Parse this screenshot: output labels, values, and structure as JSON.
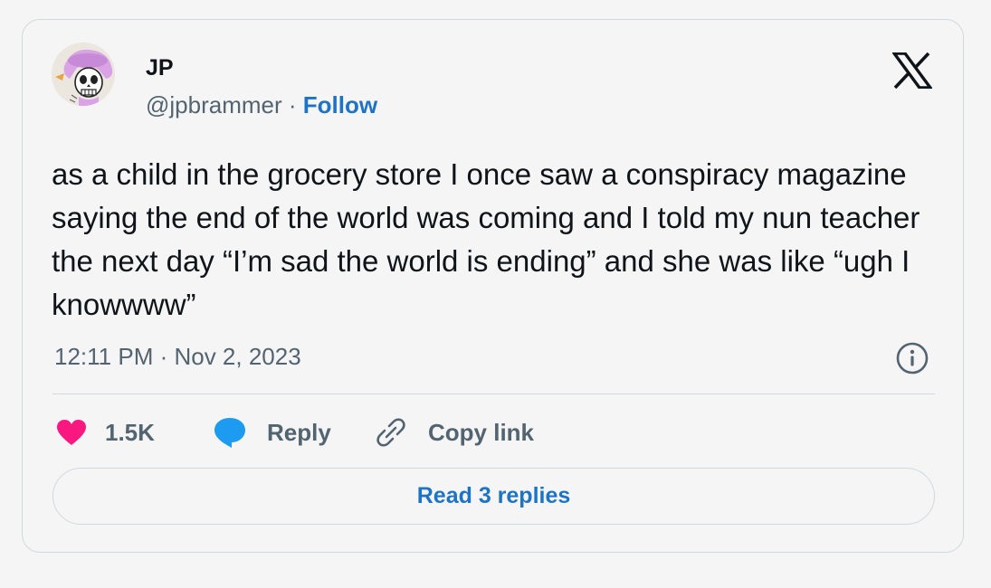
{
  "author": {
    "name": "JP",
    "handle": "@jpbrammer",
    "separator": " · ",
    "follow_label": "Follow"
  },
  "tweet": {
    "text": "as a child in the grocery store I once saw a conspiracy magazine saying the end of the world was coming and I told my nun teacher the next day “I’m sad the world is ending” and she was like “ugh I knowwww”",
    "timestamp": "12:11 PM · Nov 2, 2023"
  },
  "actions": {
    "like_count": "1.5K",
    "reply_label": "Reply",
    "copy_label": "Copy link"
  },
  "read_replies_label": "Read 3 replies",
  "icons": {
    "brand": "x-logo-icon",
    "info": "info-icon",
    "like": "heart-icon",
    "reply": "speech-bubble-icon",
    "copy": "link-icon"
  },
  "colors": {
    "like": "#f91880",
    "reply": "#1d9bf0",
    "link": "#1d74c7",
    "text": "#0f1419",
    "muted": "#536471",
    "border": "#cfd9de"
  }
}
